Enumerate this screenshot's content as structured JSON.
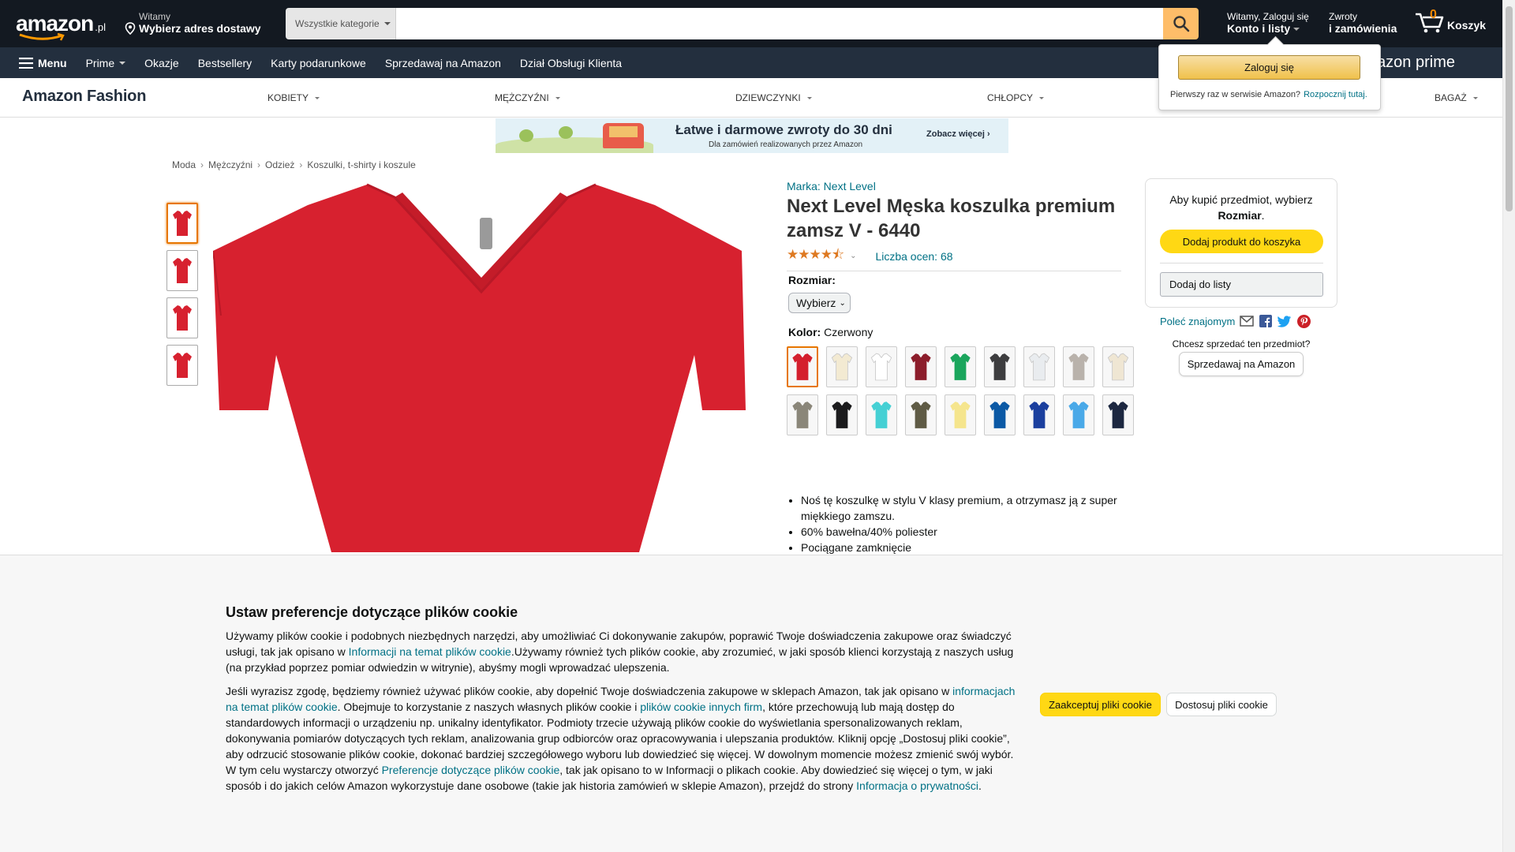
{
  "header": {
    "logo_text": "amazon",
    "logo_tld": ".pl",
    "deliver_small": "Witamy",
    "deliver_big": "Wybierz adres dostawy",
    "search_category": "Wszystkie kategorie",
    "search_value": "",
    "account_small": "Witamy, Zaloguj się",
    "account_big": "Konto i listy",
    "orders_small": "Zwroty",
    "orders_big": "i zamówienia",
    "cart_count": "0",
    "cart_label": "Koszyk"
  },
  "nav": {
    "menu": "Menu",
    "items": [
      "Prime",
      "Okazje",
      "Bestsellery",
      "Karty podarunkowe",
      "Sprzedawaj na Amazon",
      "Dział Obsługi Klienta"
    ],
    "prime_ad": "Amazon prime"
  },
  "fashion": {
    "brand": "Amazon Fashion",
    "categories": [
      "KOBIETY",
      "MĘŻCZYŹNI",
      "DZIEWCZYNKI",
      "CHŁOPCY",
      "BAGAŻ"
    ]
  },
  "signin_popover": {
    "button": "Zaloguj się",
    "new_customer": "Pierwszy raz w serwisie Amazon?",
    "start_link": "Rozpocznij tutaj."
  },
  "banner": {
    "title": "Łatwe i darmowe zwroty do 30 dni",
    "subtitle": "Dla zamówień realizowanych przez Amazon",
    "more": "Zobacz więcej ›"
  },
  "breadcrumb": [
    "Moda",
    "Mężczyźni",
    "Odzież",
    "Koszulki, t-shirty i koszule"
  ],
  "product": {
    "brand_link": "Marka: Next Level",
    "title": "Next Level Męska koszulka premium zamsz V - 6440",
    "stars": "★★★★⯪",
    "rating_value": 4.5,
    "ratings_count": "Liczba ocen: 68",
    "size_label": "Rozmiar:",
    "size_select": "Wybierz",
    "color_label": "Kolor:",
    "color_value": "Czerwony",
    "main_color": "#d7212f",
    "swatch_colors": [
      "#d41f2d",
      "#f3ead2",
      "#ffffff",
      "#8c1d2b",
      "#1aa55c",
      "#3d3d3f",
      "#e9ecef",
      "#b9b2ab",
      "#efe6d3",
      "#8a8679",
      "#1b1b1d",
      "#45d0d4",
      "#5f5b45",
      "#f5e58d",
      "#0b59a5",
      "#1b3f9e",
      "#4aa9e8",
      "#1c2740"
    ],
    "bullets": [
      "Noś tę koszulkę w stylu V klasy premium, a otrzymasz ją z super miękkiego zamszu.",
      "60% bawełna/40% poliester",
      "Pociągane zamknięcie"
    ]
  },
  "buybox": {
    "msg_part1": "Aby kupić przedmiot, wybierz",
    "msg_bold": "Rozmiar",
    "add_to_cart": "Dodaj produkt do koszyka",
    "add_to_list": "Dodaj do listy",
    "share": "Poleć znajomym",
    "sell_question": "Chcesz sprzedać ten przedmiot?",
    "sell_button": "Sprzedawaj na Amazon"
  },
  "cookie": {
    "title": "Ustaw preferencje dotyczące plików cookie",
    "p1_a": "Używamy plików cookie i podobnych niezbędnych narzędzi, aby umożliwiać Ci dokonywanie zakupów, poprawić Twoje doświadczenia zakupowe oraz świadczyć usługi, tak jak opisano w ",
    "p1_link": "Informacji na temat plików cookie",
    "p1_b": ".Używamy również tych plików cookie, aby zrozumieć, w jaki sposób klienci korzystają z naszych usług (na przykład poprzez pomiar odwiedzin w witrynie), abyśmy mogli wprowadzać ulepszenia.",
    "p2_a": "Jeśli wyrazisz zgodę, będziemy również używać plików cookie, aby dopełnić Twoje doświadczenia zakupowe w sklepach Amazon, tak jak opisano w ",
    "p2_link1": "informacjach na temat plików cookie",
    "p2_b": ". Obejmuje to korzystanie z naszych własnych plików cookie i ",
    "p2_link2": "plików cookie innych firm",
    "p2_c": ", które przechowują lub mają dostęp do standardowych informacji o urządzeniu np. unikalny identyfikator. Podmioty trzecie używają plików cookie do wyświetlania spersonalizowanych reklam, dokonywania pomiarów dotyczących tych reklam, analizowania grup odbiorców oraz opracowywania i ulepszania produktów. Kliknij opcję „Dostosuj pliki cookie”, aby odrzucić stosowanie plików cookie, dokonać bardziej szczegółowego wyboru lub dowiedzieć się więcej. W dowolnym momencie możesz zmienić swój wybór. W tym celu wystarczy otworzyć ",
    "p2_link3": "Preferencje dotyczące plików cookie",
    "p2_d": ", tak jak opisano to w Informacji o plikach cookie. Aby dowiedzieć się więcej o tym, w jaki sposób i do jakich celów Amazon wykorzystuje dane osobowe (takie jak historia zamówień w sklepie Amazon), przejdź do strony ",
    "p2_link4": "Informacja o prywatności",
    "p2_e": ".",
    "accept": "Zaakceptuj pliki cookie",
    "customize": "Dostosuj pliki cookie"
  }
}
